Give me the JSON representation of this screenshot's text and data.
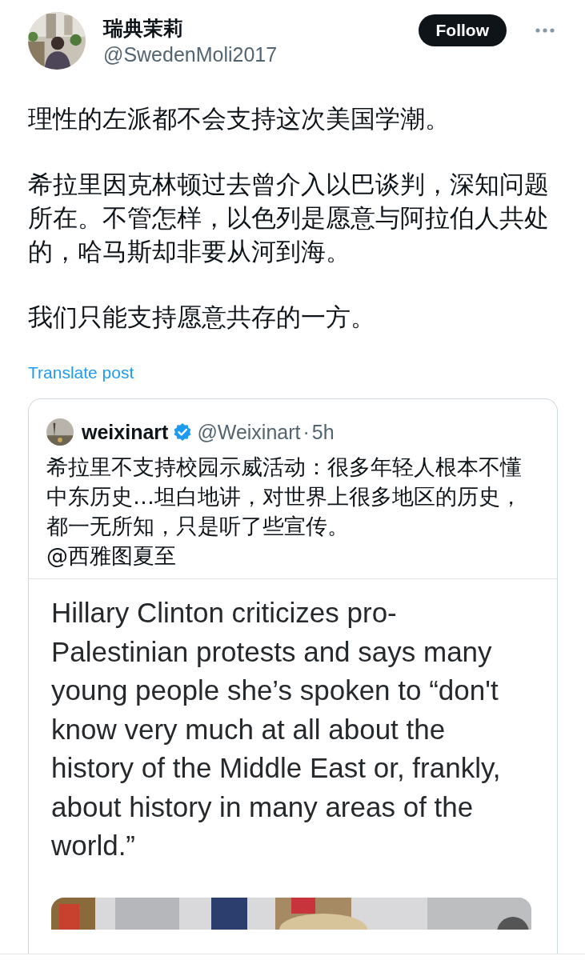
{
  "author": {
    "name": "瑞典茉莉",
    "handle": "@SwedenMoli2017",
    "avatar": {
      "kind": "picture"
    }
  },
  "follow_button": {
    "label": "Follow",
    "following": false
  },
  "post": {
    "paragraphs": [
      "理性的左派都不会支持这次美国学潮。",
      "希拉里因克林顿过去曾介入以巴谈判，深知问题所在。不管怎样，以色列是愿意与阿拉伯人共处的，哈马斯却非要从河到海。",
      "我们只能支持愿意共存的一方。"
    ]
  },
  "translate_link": "Translate post",
  "quoted_post": {
    "author": {
      "name": "weixinart",
      "verified": true,
      "handle": "@Weixinart",
      "separator": "·",
      "time": "5h"
    },
    "lines": [
      "希拉里不支持校园示威活动：很多年轻人根本不懂中东历史…坦白地讲，对世界上很多地区的历史，都一无所知，只是听了些宣传。",
      "@西雅图夏至"
    ],
    "headline": "Hillary Clinton criticizes pro-\nPalestinian protests and says many\nyoung people she’s spoken to “don't\nknow very much at all about the\nhistory of the Middle East or, frankly,\nabout history in many areas of the\nworld.”",
    "media": {
      "kind": "picture"
    }
  }
}
